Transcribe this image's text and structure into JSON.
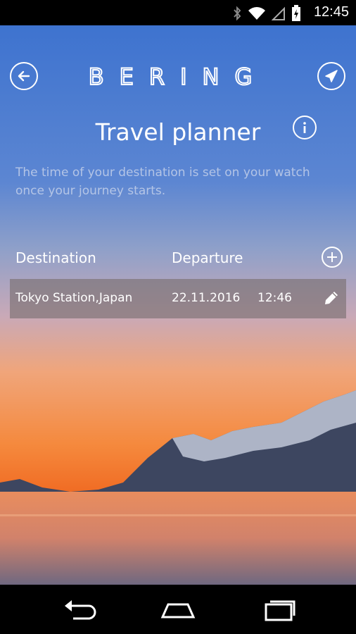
{
  "status_bar": {
    "time": "12:45",
    "icons": [
      "bluetooth-icon",
      "wifi-icon",
      "signal-icon",
      "battery-icon"
    ]
  },
  "header": {
    "logo_text": "BERING",
    "back_icon": "arrow-left-icon",
    "plane_icon": "airplane-icon"
  },
  "main": {
    "title": "Travel planner",
    "info_icon": "info-icon",
    "info_text": "The time of your destination is set on your watch once your journey starts.",
    "columns": {
      "destination": "Destination",
      "departure": "Departure"
    },
    "trips": [
      {
        "destination": "Tokyo Station,Japan",
        "date": "22.11.2016",
        "time": "12:46"
      }
    ]
  },
  "navigation": {
    "items": [
      "back-nav-icon",
      "home-nav-icon",
      "recents-nav-icon"
    ]
  },
  "colors": {
    "sky_top": "#3e73cf",
    "sunset_orange": "#f5893d",
    "row_bg": "rgba(120,110,110,0.62)",
    "text": "#ffffff"
  }
}
